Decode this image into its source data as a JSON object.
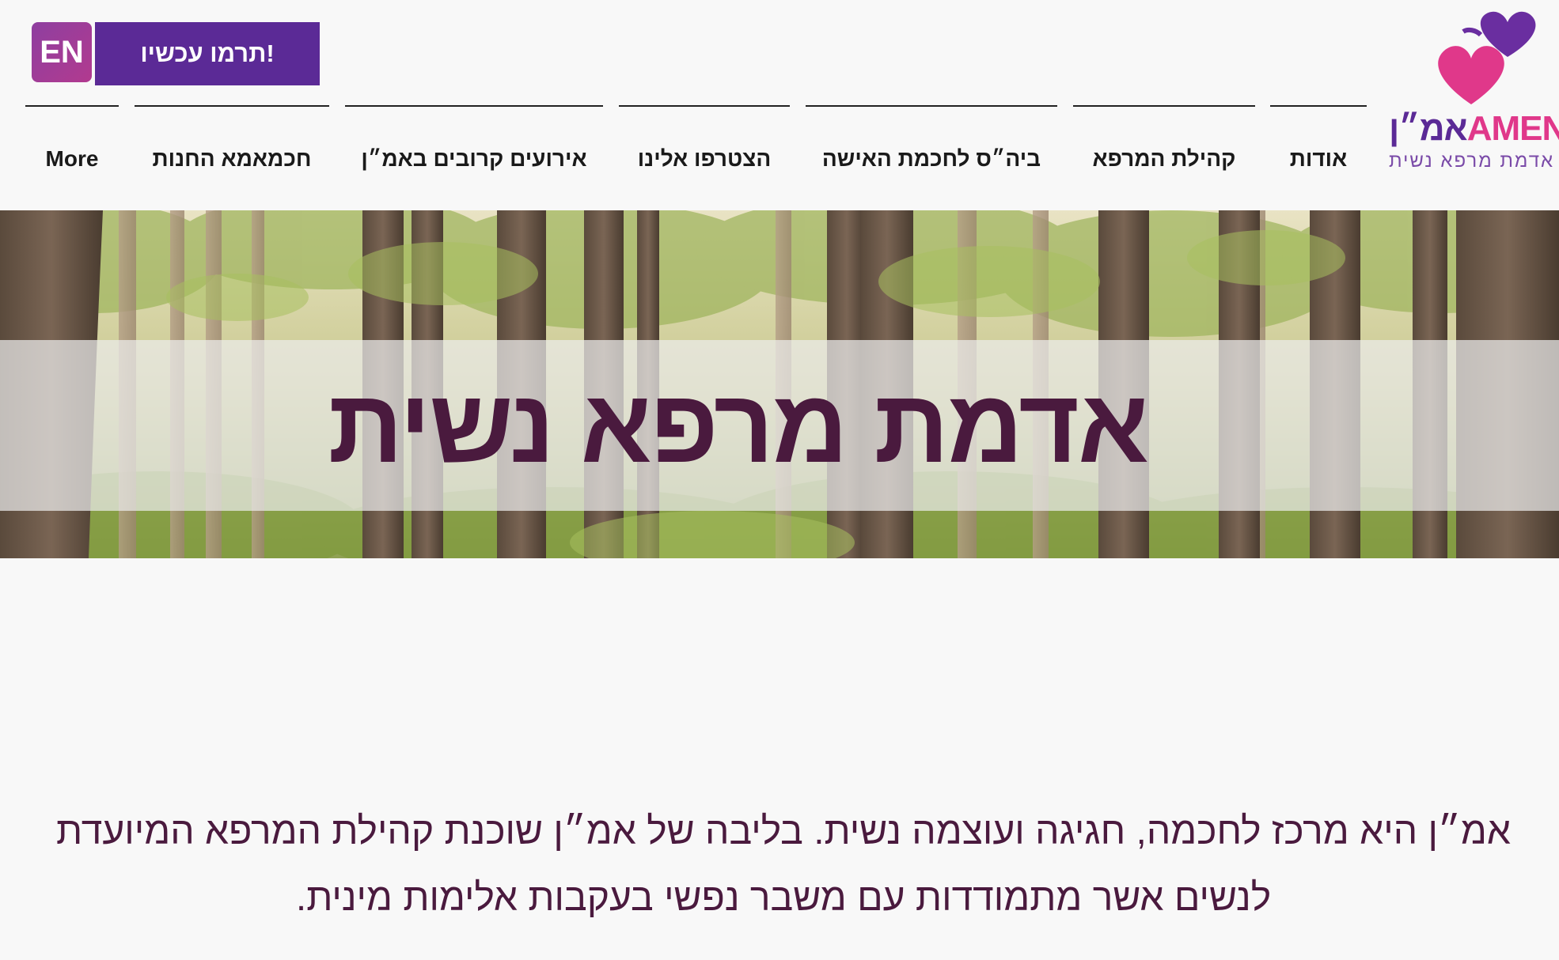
{
  "header": {
    "language_button": "EN",
    "donate_button": "תרמו עכשיו!",
    "logo": {
      "hebrew_word": "אמ״ן",
      "latin_word": "AMEN",
      "tagline": "אדמת מרפא נשית"
    },
    "nav": [
      {
        "label": "אודות"
      },
      {
        "label": "קהילת המרפא"
      },
      {
        "label": "ביה״ס לחכמת האישה"
      },
      {
        "label": "הצטרפו אלינו"
      },
      {
        "label": "אירועים קרובים באמ״ן"
      },
      {
        "label": "חכמאמא החנות"
      },
      {
        "label": "More"
      }
    ]
  },
  "hero": {
    "title": "אדמת מרפא נשית"
  },
  "intro": {
    "text": "אמ״ן היא מרכז לחכמה, חגיגה ועוצמה נשית. בליבה של אמ״ן שוכנת קהילת המרפא המיועדת לנשים אשר מתמודדות עם משבר נפשי בעקבות אלימות מינית."
  },
  "colors": {
    "accent_purple": "#5b2a96",
    "accent_pink": "#e0388a",
    "title_color": "#4a1a3e"
  }
}
